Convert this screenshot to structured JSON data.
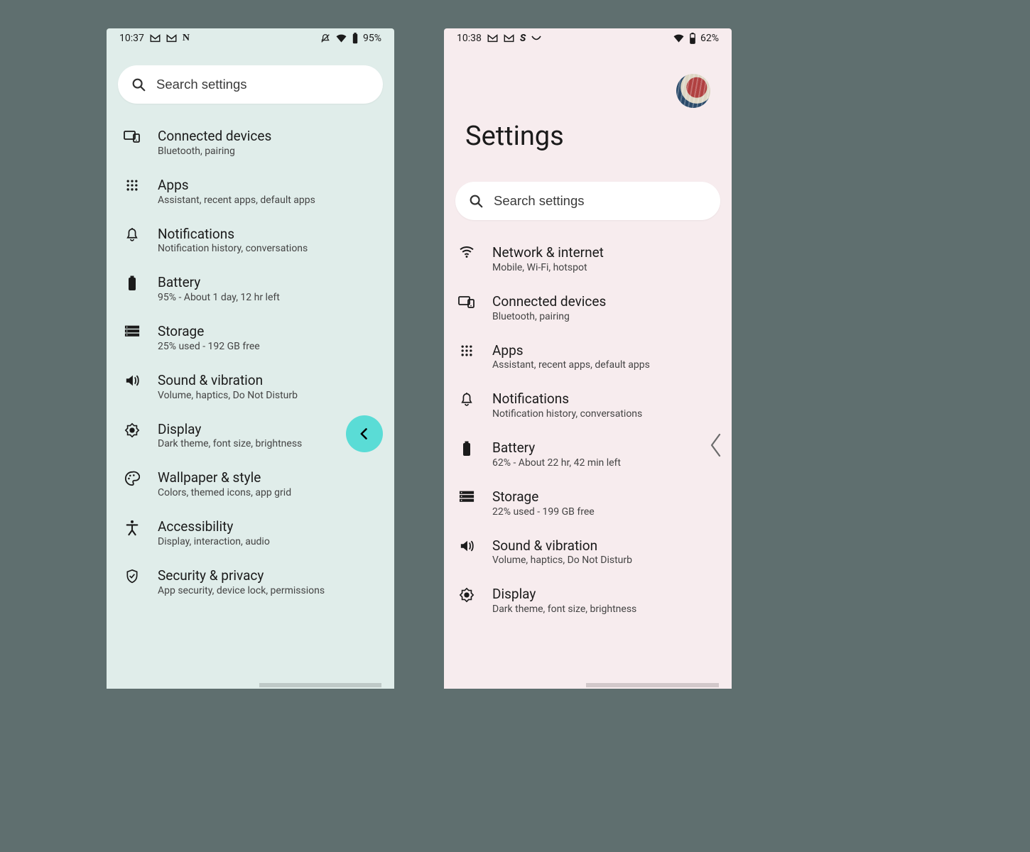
{
  "left": {
    "status": {
      "time": "10:37",
      "battery": "95%"
    },
    "search_placeholder": "Search settings",
    "rows": [
      {
        "title": "Connected devices",
        "sub": "Bluetooth, pairing"
      },
      {
        "title": "Apps",
        "sub": "Assistant, recent apps, default apps"
      },
      {
        "title": "Notifications",
        "sub": "Notification history, conversations"
      },
      {
        "title": "Battery",
        "sub": "95% - About 1 day, 12 hr left"
      },
      {
        "title": "Storage",
        "sub": "25% used - 192 GB free"
      },
      {
        "title": "Sound & vibration",
        "sub": "Volume, haptics, Do Not Disturb"
      },
      {
        "title": "Display",
        "sub": "Dark theme, font size, brightness"
      },
      {
        "title": "Wallpaper & style",
        "sub": "Colors, themed icons, app grid"
      },
      {
        "title": "Accessibility",
        "sub": "Display, interaction, audio"
      },
      {
        "title": "Security & privacy",
        "sub": "App security, device lock, permissions"
      }
    ]
  },
  "right": {
    "status": {
      "time": "10:38",
      "battery": "62%"
    },
    "page_title": "Settings",
    "search_placeholder": "Search settings",
    "rows": [
      {
        "title": "Network & internet",
        "sub": "Mobile, Wi-Fi, hotspot"
      },
      {
        "title": "Connected devices",
        "sub": "Bluetooth, pairing"
      },
      {
        "title": "Apps",
        "sub": "Assistant, recent apps, default apps"
      },
      {
        "title": "Notifications",
        "sub": "Notification history, conversations"
      },
      {
        "title": "Battery",
        "sub": "62% - About 22 hr, 42 min left"
      },
      {
        "title": "Storage",
        "sub": "22% used - 199 GB free"
      },
      {
        "title": "Sound & vibration",
        "sub": "Volume, haptics, Do Not Disturb"
      },
      {
        "title": "Display",
        "sub": "Dark theme, font size, brightness"
      }
    ]
  }
}
